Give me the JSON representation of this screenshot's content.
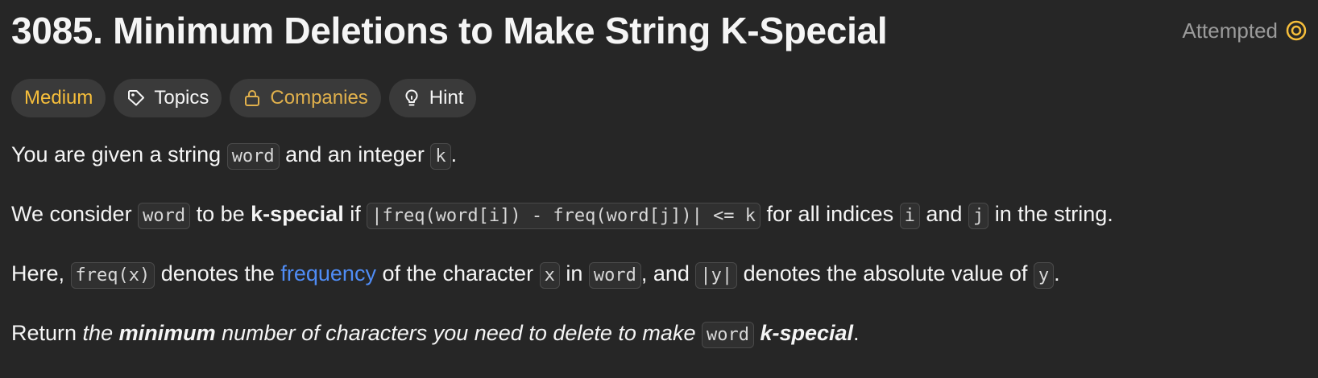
{
  "problem": {
    "title": "3085. Minimum Deletions to Make String K-Special",
    "status": "Attempted"
  },
  "tags": {
    "difficulty": "Medium",
    "topics": "Topics",
    "companies": "Companies",
    "hint": "Hint"
  },
  "colors": {
    "background": "#262626",
    "difficulty_medium": "#f6be3b",
    "link": "#4f8cf5",
    "status": "#9b9b9b",
    "status_icon": "#f6be3b"
  },
  "icons": {
    "status": "attempted-ring-icon",
    "topics": "tag-icon",
    "companies": "lock-icon",
    "hint": "lightbulb-icon"
  },
  "description": {
    "p1": {
      "t1": "You are given a string ",
      "c1": "word",
      "t2": " and an integer ",
      "c2": "k",
      "t3": "."
    },
    "p2": {
      "t1": "We consider ",
      "c1": "word",
      "t2": " to be ",
      "b1": "k-special",
      "t3": " if ",
      "c2": "|freq(word[i]) - freq(word[j])| <= k",
      "t4": " for all indices ",
      "c3": "i",
      "t5": " and ",
      "c4": "j",
      "t6": " in the string."
    },
    "p3": {
      "t1": "Here, ",
      "c1": "freq(x)",
      "t2": " denotes the ",
      "link": "frequency",
      "t3": " of the character ",
      "c2": "x",
      "t4": " in ",
      "c3": "word",
      "t5": ", and ",
      "c4": "|y|",
      "t6": " denotes the absolute value of ",
      "c5": "y",
      "t7": "."
    },
    "p4": {
      "t1": "Return ",
      "i1": "the ",
      "b1": "minimum",
      "i2": " number of characters you need to delete to make ",
      "c1": "word",
      "t2": " ",
      "b2": "k-special",
      "t3": "."
    }
  }
}
